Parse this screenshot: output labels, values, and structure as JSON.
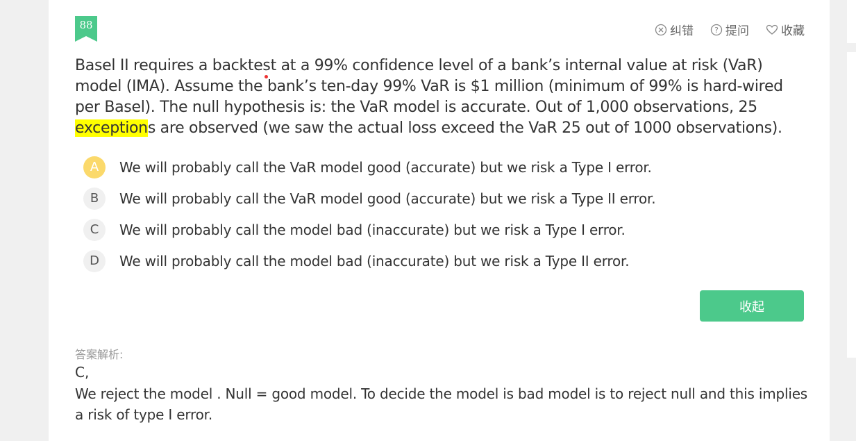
{
  "question_number": "88",
  "actions": {
    "report_label": "纠错",
    "ask_label": "提问",
    "favorite_label": "收藏"
  },
  "question": {
    "text_before_highlight": "Basel II requires a backtest at a 99% confidence level of a bank’s internal value at risk (VaR) model (IMA). Assume the bank’s ten-day 99% VaR is $1 million (minimum of 99% is hard-wired per Basel). The null hypothesis is: the VaR model is accurate. Out of 1,000 observations, 25 ",
    "highlight": "exception",
    "text_after_highlight": "s are observed (we saw the actual loss exceed the VaR 25 out of 1000 observations)."
  },
  "options": [
    {
      "letter": "A",
      "text": "We will probably call the VaR model good (accurate) but we risk a Type I error.",
      "selected": true
    },
    {
      "letter": "B",
      "text": "We will probably call the VaR model good (accurate) but we risk a Type II error.",
      "selected": false
    },
    {
      "letter": "C",
      "text": "We will probably call the model bad (inaccurate) but we risk a Type I error.",
      "selected": false
    },
    {
      "letter": "D",
      "text": "We will probably call the model bad (inaccurate) but we risk a Type II error.",
      "selected": false
    }
  ],
  "collapse_label": "收起",
  "analysis": {
    "label": "答案解析:",
    "answer": "C,",
    "explanation": "We reject the model . Null = good model. To decide the model is bad model is to reject null and this implies a risk of type I error."
  },
  "colors": {
    "accent_green": "#4cc98b",
    "selected_option": "#fbd96b",
    "highlight": "#ffff00"
  }
}
